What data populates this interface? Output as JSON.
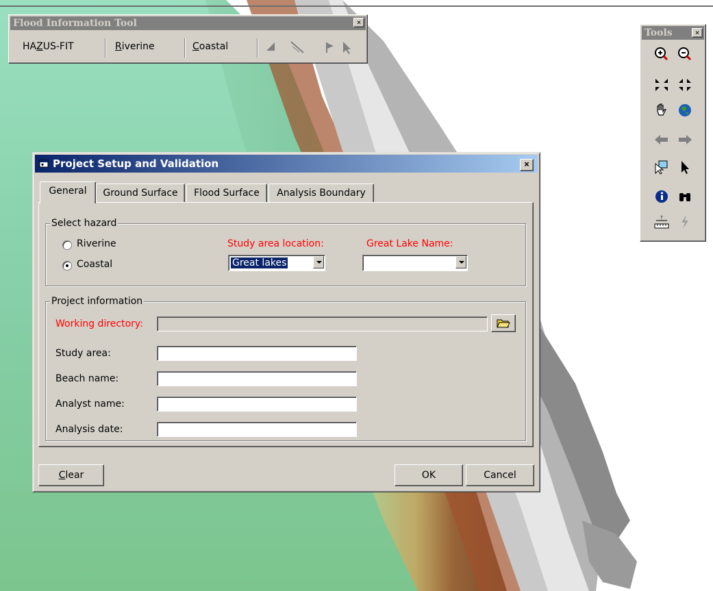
{
  "flood_toolbar": {
    "title": "Flood Information Tool",
    "close_label": "×",
    "menu": [
      {
        "label": "HAZUS-FIT"
      },
      {
        "label": "Riverine"
      },
      {
        "label": "Coastal"
      }
    ],
    "icons": [
      "add-flag-icon",
      "transect-icon",
      "flag-icon",
      "pointer-icon"
    ]
  },
  "tools_palette": {
    "title": "Tools",
    "close_label": "×",
    "icons": [
      "zoom-in-icon",
      "zoom-out-icon",
      "fixed-zoom-in-icon",
      "fixed-zoom-out-icon",
      "pan-hand-icon",
      "full-extent-globe-icon",
      "back-arrow-icon",
      "forward-arrow-icon",
      "select-features-icon",
      "select-elements-icon",
      "identify-icon",
      "find-binoculars-icon",
      "measure-icon",
      "hyperlink-icon"
    ]
  },
  "dialog": {
    "title": "Project Setup and Validation",
    "close_label": "×",
    "tabs": [
      {
        "label": "General",
        "active": true
      },
      {
        "label": "Ground Surface",
        "active": false
      },
      {
        "label": "Flood Surface",
        "active": false
      },
      {
        "label": "Analysis Boundary",
        "active": false
      }
    ],
    "select_hazard": {
      "legend": "Select hazard",
      "riverine_label": "Riverine",
      "coastal_label": "Coastal",
      "selected": "Coastal",
      "study_area_location_label": "Study area location:",
      "study_area_location_value": "Great lakes",
      "great_lake_name_label": "Great Lake Name:",
      "great_lake_name_value": ""
    },
    "project_information": {
      "legend": "Project information",
      "working_directory_label": "Working directory:",
      "working_directory_value": "",
      "study_area_label": "Study area:",
      "study_area_value": "",
      "beach_name_label": "Beach name:",
      "beach_name_value": "",
      "analyst_name_label": "Analyst name:",
      "analyst_name_value": "",
      "analysis_date_label": "Analysis date:",
      "analysis_date_value": ""
    },
    "buttons": {
      "clear": "Clear",
      "ok": "OK",
      "cancel": "Cancel"
    }
  },
  "colors": {
    "titlebar_start": "#0a246a",
    "titlebar_end": "#a6caf0",
    "required_label": "#ff0000",
    "window_face": "#d4d0c8"
  }
}
